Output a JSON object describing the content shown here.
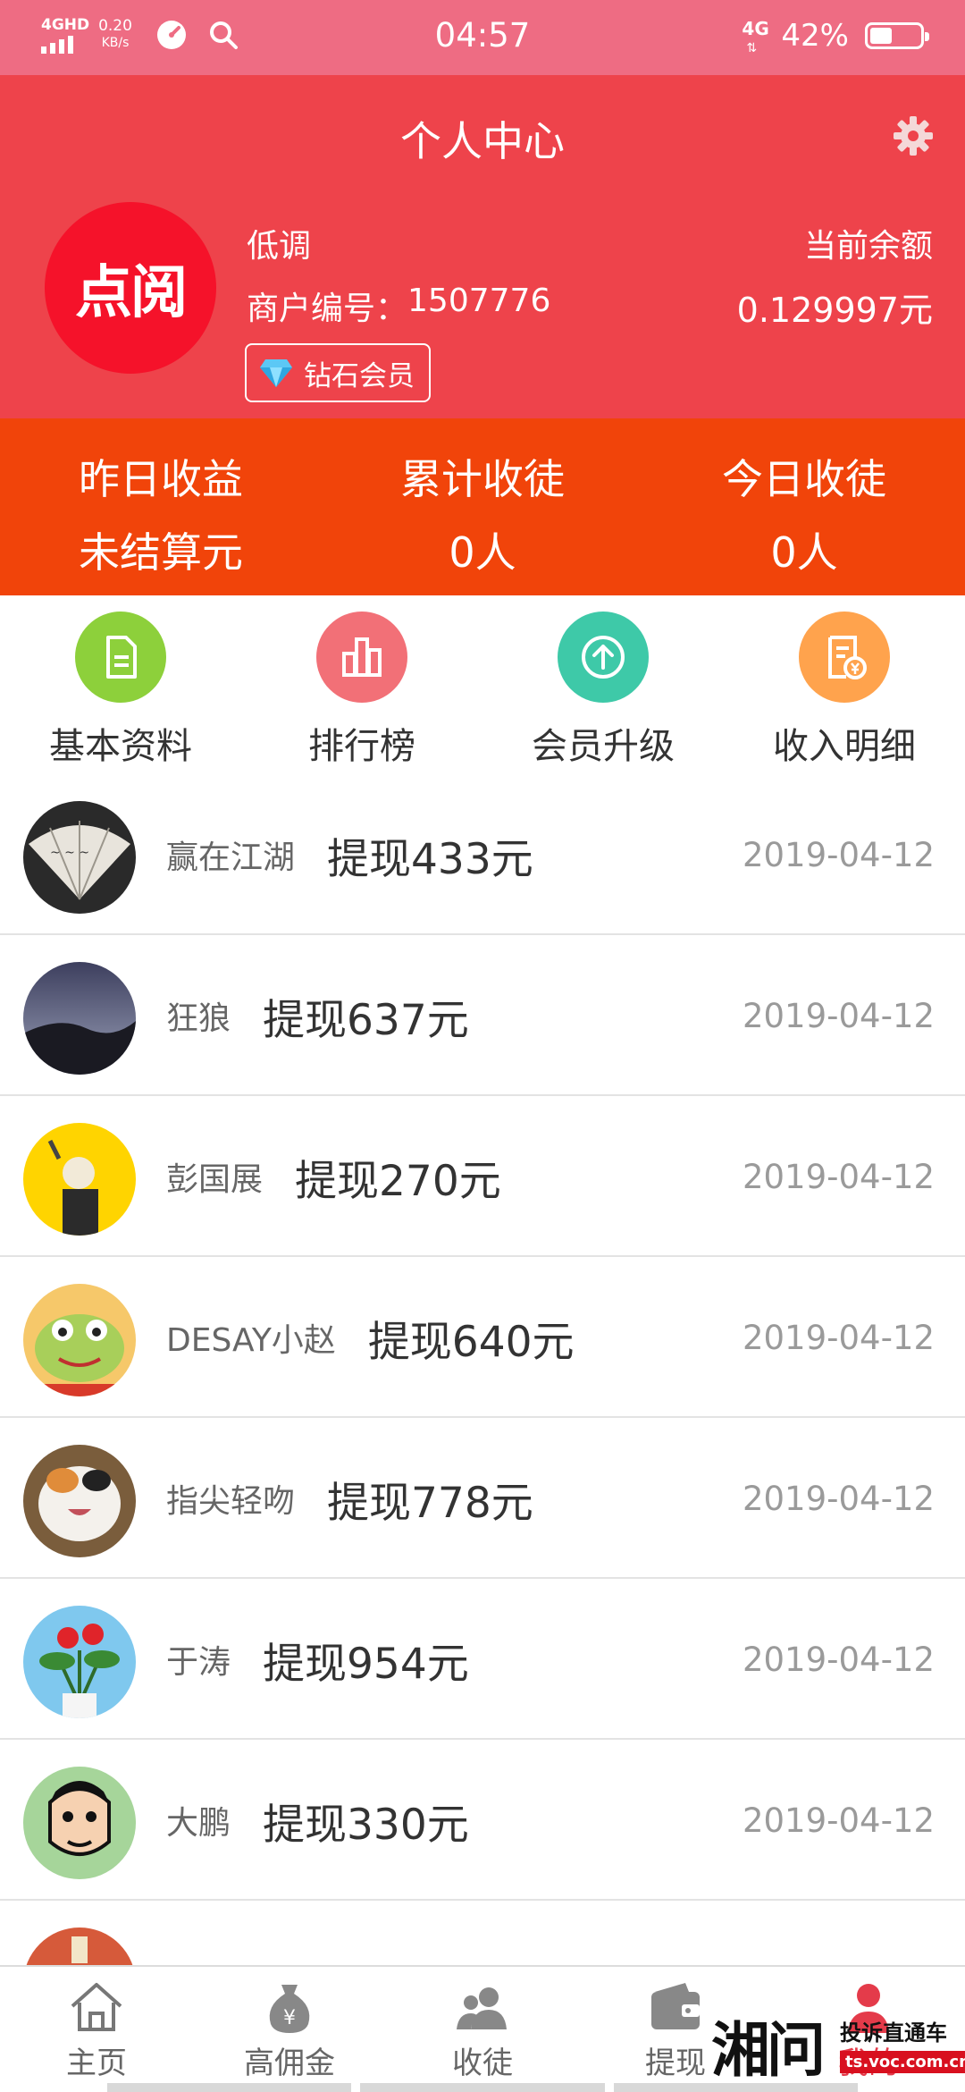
{
  "status_bar": {
    "network": "4GHD",
    "speed_value": "0.20",
    "speed_unit": "KB/s",
    "time": "04:57",
    "network_right": "4G",
    "battery": "42%"
  },
  "header": {
    "title": "个人中心",
    "logo_text": "点阅",
    "nickname": "低调",
    "merchant_label": "商户编号：",
    "merchant_id": "1507776",
    "badge_label": "钻石会员",
    "balance_label": "当前余额",
    "balance_value": "0.129997元"
  },
  "stats": [
    {
      "label": "昨日收益",
      "value": "未结算元"
    },
    {
      "label": "累计收徒",
      "value": "0人"
    },
    {
      "label": "今日收徒",
      "value": "0人"
    }
  ],
  "menu": [
    {
      "label": "基本资料",
      "icon": "document-icon",
      "color": "#8dd03b"
    },
    {
      "label": "排行榜",
      "icon": "bar-chart-icon",
      "color": "#f27077"
    },
    {
      "label": "会员升级",
      "icon": "upgrade-arrow-icon",
      "color": "#3ec9a8"
    },
    {
      "label": "收入明细",
      "icon": "income-detail-icon",
      "color": "#ffa34d"
    }
  ],
  "withdrawals": [
    {
      "name": "赢在江湖",
      "amount": "提现433元",
      "date": "2019-04-12"
    },
    {
      "name": "狂狼",
      "amount": "提现637元",
      "date": "2019-04-12"
    },
    {
      "name": "彭国展",
      "amount": "提现270元",
      "date": "2019-04-12"
    },
    {
      "name": "DESAY小赵",
      "amount": "提现640元",
      "date": "2019-04-12"
    },
    {
      "name": "指尖轻吻",
      "amount": "提现778元",
      "date": "2019-04-12"
    },
    {
      "name": "于涛",
      "amount": "提现954元",
      "date": "2019-04-12"
    },
    {
      "name": "大鹏",
      "amount": "提现330元",
      "date": "2019-04-12"
    }
  ],
  "tabbar": [
    {
      "label": "主页",
      "icon": "home-icon"
    },
    {
      "label": "高佣金",
      "icon": "money-bag-icon"
    },
    {
      "label": "收徒",
      "icon": "users-icon"
    },
    {
      "label": "提现",
      "icon": "wallet-icon"
    },
    {
      "label": "我的",
      "icon": "profile-icon",
      "active": true
    }
  ],
  "watermark": {
    "brand": "湘问",
    "tagline": "投诉直通车",
    "url": "ts.voc.com.cn"
  },
  "colors": {
    "status_bar": "#ee6c83",
    "header": "#ee434b",
    "stats": "#f1440a",
    "active_tab": "#e43b4a"
  }
}
